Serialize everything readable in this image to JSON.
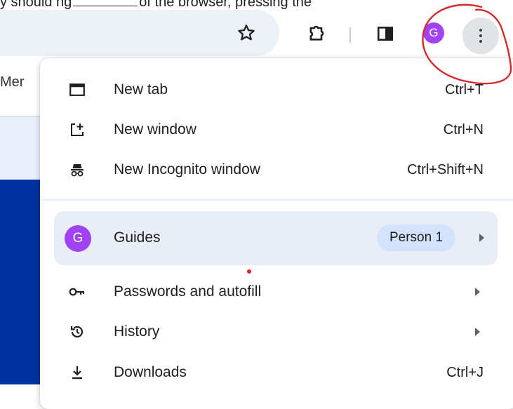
{
  "doc": {
    "top_snippet_left": "y should ng",
    "top_snippet_right": "of the browser, pressing the"
  },
  "toolbar": {
    "avatar_initial": "G"
  },
  "page": {
    "partial_text": "Mer"
  },
  "menu": {
    "items_top": [
      {
        "label": "New tab",
        "shortcut": "Ctrl+T",
        "icon": "new-tab-icon"
      },
      {
        "label": "New window",
        "shortcut": "Ctrl+N",
        "icon": "new-window-icon"
      },
      {
        "label": "New Incognito window",
        "shortcut": "Ctrl+Shift+N",
        "icon": "incognito-icon"
      }
    ],
    "profile": {
      "initial": "G",
      "name": "Guides",
      "chip": "Person 1"
    },
    "items_bottom": [
      {
        "label": "Passwords and autofill",
        "shortcut": "",
        "icon": "key-icon",
        "submenu": true
      },
      {
        "label": "History",
        "shortcut": "",
        "icon": "history-icon",
        "submenu": true
      },
      {
        "label": "Downloads",
        "shortcut": "Ctrl+J",
        "icon": "download-icon",
        "submenu": false
      }
    ]
  },
  "colors": {
    "avatar": "#a142f4",
    "profile_row_bg": "#e9edf6",
    "chip_bg": "#d3e3fd",
    "annotation": "#d42a2a",
    "page_blue": "#0033a0"
  }
}
